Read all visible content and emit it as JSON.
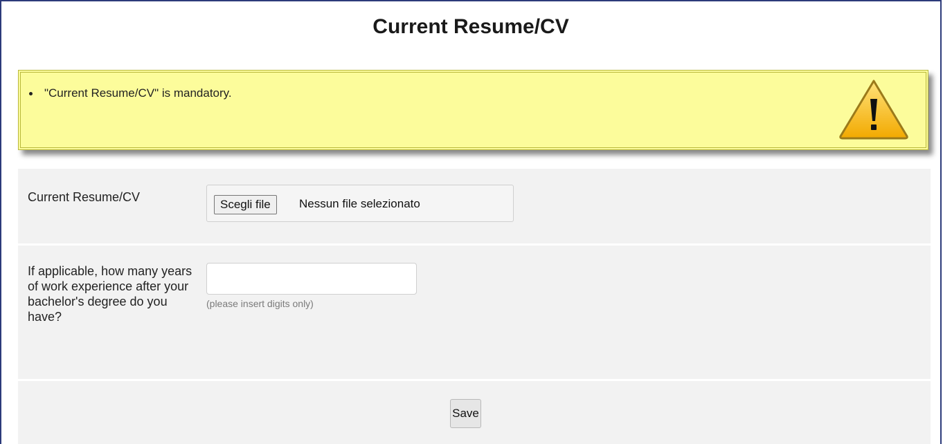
{
  "page": {
    "title": "Current Resume/CV"
  },
  "alert": {
    "messages": [
      "\"Current Resume/CV\" is mandatory."
    ],
    "icon": "warning-triangle-icon",
    "background": "#fcfc9b",
    "border": "#b9b83c"
  },
  "form": {
    "resume": {
      "label": "Current Resume/CV",
      "button_label": "Scegli file",
      "status": "Nessun file selezionato"
    },
    "experience": {
      "label": "If applicable, how many years of work experience after your bachelor's degree do you have?",
      "value": "",
      "hint": "(please insert digits only)"
    },
    "save_label": "Save"
  }
}
